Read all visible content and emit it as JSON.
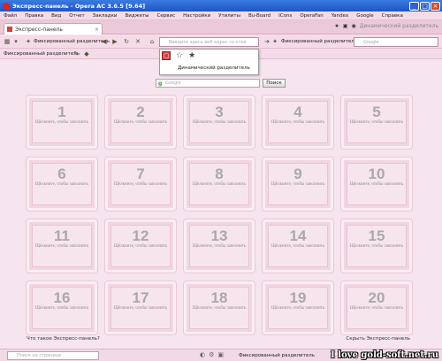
{
  "window": {
    "title": "Экспресс-панель - Opera AC 3.6.5 [9.64]"
  },
  "menu": [
    "Файл",
    "Правка",
    "Вид",
    "Отчет",
    "Закладки",
    "Виджеты",
    "Сервис",
    "Настройки",
    "Утилиты",
    "Bu-Board",
    "ICons",
    "OperaFan",
    "Yandex",
    "Google",
    "Справка"
  ],
  "tab": {
    "label": "Экспресс-панель",
    "close": "×"
  },
  "tabbar": {
    "dynamic_label": "Динамический разделитель"
  },
  "toolbar": {
    "fixed_separator": "Фиксированный разделитель",
    "address_placeholder": "Введите здесь веб-адрес со стки",
    "fixed_separator_right": "Фиксированный разделитель",
    "search_placeholder": "Google"
  },
  "bookmarkbar": {
    "label": "Фиксированный разделитель"
  },
  "dropdown": {
    "label": "Динамический разделитель"
  },
  "search": {
    "placeholder": "Google",
    "button": "Поиск"
  },
  "cells": [
    {
      "number": "1",
      "hint": "Щёлкните, чтобы заполнить"
    },
    {
      "number": "2",
      "hint": "Щёлкните, чтобы заполнить"
    },
    {
      "number": "3",
      "hint": "Щёлкните, чтобы заполнить"
    },
    {
      "number": "4",
      "hint": "Щёлкните, чтобы заполнить"
    },
    {
      "number": "5",
      "hint": "Щёлкните, чтобы заполнить"
    },
    {
      "number": "6",
      "hint": "Щёлкните, чтобы заполнить"
    },
    {
      "number": "7",
      "hint": "Щёлкните, чтобы заполнить"
    },
    {
      "number": "8",
      "hint": "Щёлкните, чтобы заполнить"
    },
    {
      "number": "9",
      "hint": "Щёлкните, чтобы заполнить"
    },
    {
      "number": "10",
      "hint": "Щёлкните, чтобы заполнить"
    },
    {
      "number": "11",
      "hint": "Щёлкните, чтобы заполнить"
    },
    {
      "number": "12",
      "hint": "Щёлкните, чтобы заполнить"
    },
    {
      "number": "13",
      "hint": "Щёлкните, чтобы заполнить"
    },
    {
      "number": "14",
      "hint": "Щёлкните, чтобы заполнить"
    },
    {
      "number": "15",
      "hint": "Щёлкните, чтобы заполнить"
    },
    {
      "number": "16",
      "hint": "Щёлкните, чтобы заполнить"
    },
    {
      "number": "17",
      "hint": "Щёлкните, чтобы заполнить"
    },
    {
      "number": "18",
      "hint": "Щёлкните, чтобы заполнить"
    },
    {
      "number": "19",
      "hint": "Щёлкните, чтобы заполнить"
    },
    {
      "number": "20",
      "hint": "Щёлкните, чтобы заполнить"
    }
  ],
  "footer": {
    "left": "Что такое Экспресс-панель?",
    "right": "Скрыть Экспресс-панель"
  },
  "status": {
    "search_placeholder": "Поиск на странице",
    "label": "Фиксированный разделитель",
    "watermark": "I love gold-soft.net.ru"
  }
}
